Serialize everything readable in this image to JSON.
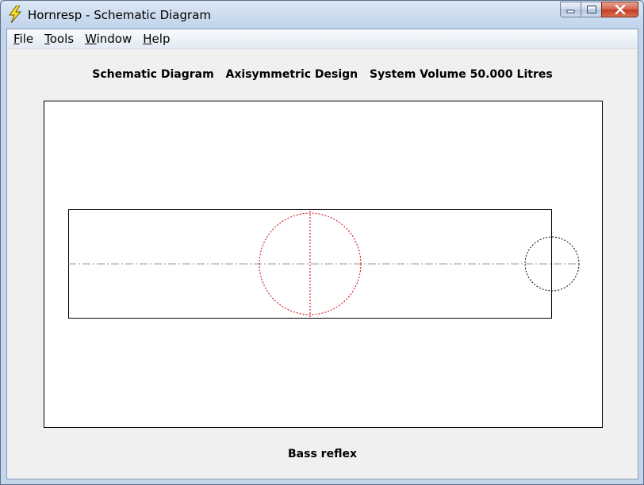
{
  "window": {
    "title": "Hornresp - Schematic Diagram"
  },
  "menu": {
    "items": [
      {
        "mnemonic": "F",
        "rest": "ile"
      },
      {
        "mnemonic": "T",
        "rest": "ools"
      },
      {
        "mnemonic": "W",
        "rest": "indow"
      },
      {
        "mnemonic": "H",
        "rest": "elp"
      }
    ]
  },
  "diagram": {
    "header_parts": [
      "Schematic Diagram",
      "Axisymmetric Design",
      "System Volume 50.000 Litres"
    ],
    "footer": "Bass reflex"
  },
  "icons": {
    "app": "lightning-bolt-icon"
  },
  "colors": {
    "driver_circle": "#d00000",
    "port_circle": "#000000",
    "centerline": "#9a9a9a"
  }
}
